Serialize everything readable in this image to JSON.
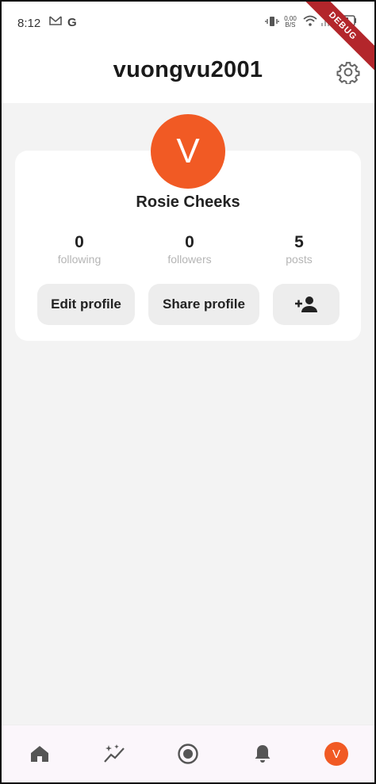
{
  "status_bar": {
    "time": "8:12",
    "gmail_icon": "gmail-icon",
    "google_icon": "google-icon",
    "net_speed": "0,00 B/S"
  },
  "debug_banner": "DEBUG",
  "header": {
    "title": "vuongvu2001"
  },
  "profile": {
    "avatar_letter": "V",
    "display_name": "Rosie Cheeks",
    "stats": [
      {
        "value": "0",
        "label": "following"
      },
      {
        "value": "0",
        "label": "followers"
      },
      {
        "value": "5",
        "label": "posts"
      }
    ],
    "buttons": {
      "edit": "Edit profile",
      "share": "Share profile"
    }
  },
  "bottom_nav": {
    "avatar_letter": "V"
  },
  "colors": {
    "accent": "#f15a24",
    "background": "#f3f3f3",
    "button_bg": "#ededed"
  }
}
